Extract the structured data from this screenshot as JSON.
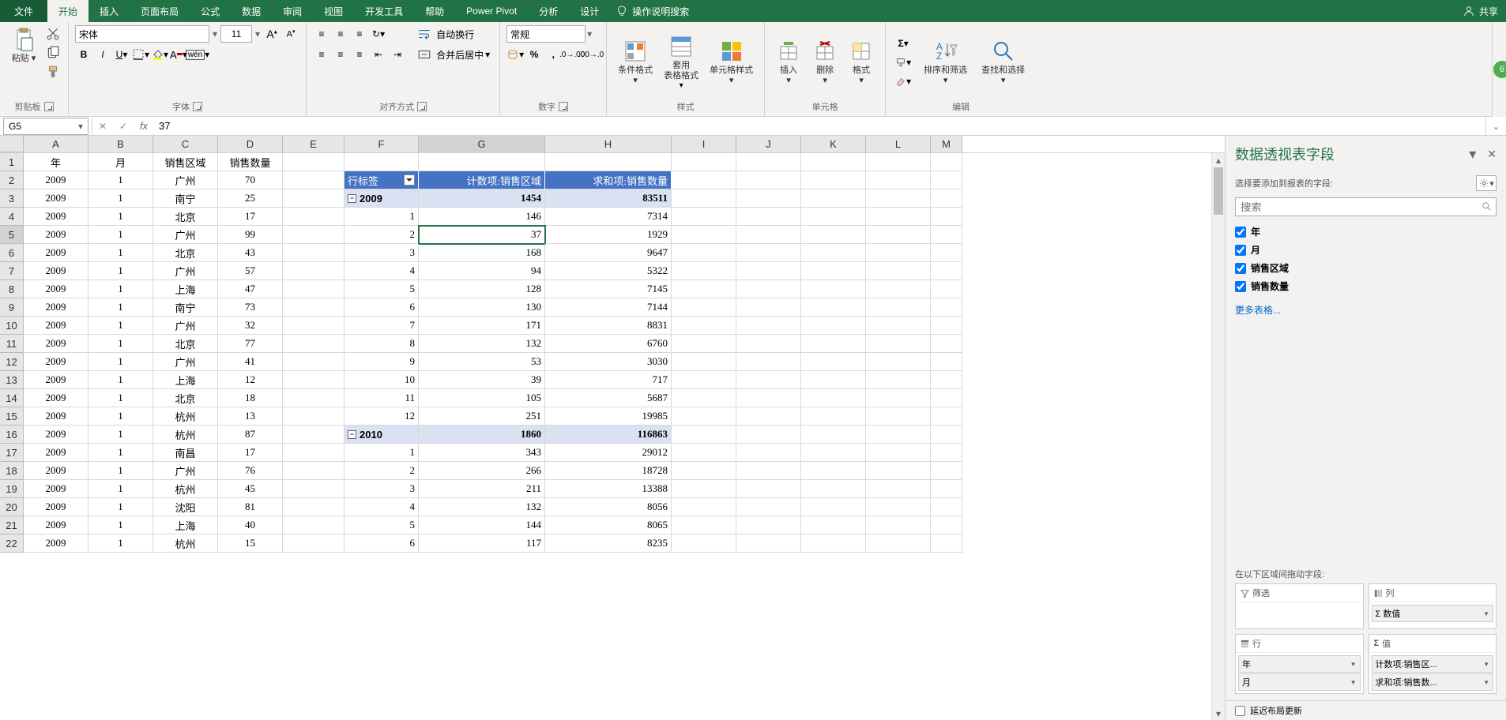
{
  "tabs": {
    "file": "文件",
    "home": "开始",
    "insert": "插入",
    "layout": "页面布局",
    "formulas": "公式",
    "data": "数据",
    "review": "审阅",
    "view": "视图",
    "dev": "开发工具",
    "help": "帮助",
    "pivot": "Power Pivot",
    "analyze": "分析",
    "design": "设计"
  },
  "search_hint": "操作说明搜索",
  "share": "共享",
  "ribbon": {
    "clipboard": {
      "paste": "粘贴",
      "label": "剪贴板"
    },
    "font": {
      "name": "宋体",
      "size": "11",
      "label": "字体"
    },
    "align": {
      "wrap": "自动换行",
      "merge": "合并后居中",
      "label": "对齐方式"
    },
    "number": {
      "format": "常规",
      "label": "数字"
    },
    "styles": {
      "cond": "条件格式",
      "table": "套用\n表格格式",
      "cell": "单元格样式",
      "label": "样式"
    },
    "cells": {
      "insert": "插入",
      "delete": "删除",
      "format": "格式",
      "label": "单元格"
    },
    "editing": {
      "sort": "排序和筛选",
      "find": "查找和选择",
      "label": "编辑"
    },
    "badge": "6"
  },
  "name_box": "G5",
  "formula": "37",
  "columns": [
    "A",
    "B",
    "C",
    "D",
    "E",
    "F",
    "G",
    "H",
    "I",
    "J",
    "K",
    "L",
    "M"
  ],
  "col_widths": [
    "w-A",
    "w-B",
    "w-C",
    "w-D",
    "w-E",
    "w-F",
    "w-G",
    "w-H",
    "w-I",
    "w-J",
    "w-K",
    "w-L",
    "w-M"
  ],
  "headers": {
    "A": "年",
    "B": "月",
    "C": "销售区域",
    "D": "销售数量"
  },
  "source_rows": [
    [
      "2009",
      "1",
      "广州",
      "70"
    ],
    [
      "2009",
      "1",
      "南宁",
      "25"
    ],
    [
      "2009",
      "1",
      "北京",
      "17"
    ],
    [
      "2009",
      "1",
      "广州",
      "99"
    ],
    [
      "2009",
      "1",
      "北京",
      "43"
    ],
    [
      "2009",
      "1",
      "广州",
      "57"
    ],
    [
      "2009",
      "1",
      "上海",
      "47"
    ],
    [
      "2009",
      "1",
      "南宁",
      "73"
    ],
    [
      "2009",
      "1",
      "广州",
      "32"
    ],
    [
      "2009",
      "1",
      "北京",
      "77"
    ],
    [
      "2009",
      "1",
      "广州",
      "41"
    ],
    [
      "2009",
      "1",
      "上海",
      "12"
    ],
    [
      "2009",
      "1",
      "北京",
      "18"
    ],
    [
      "2009",
      "1",
      "杭州",
      "13"
    ],
    [
      "2009",
      "1",
      "杭州",
      "87"
    ],
    [
      "2009",
      "1",
      "南昌",
      "17"
    ],
    [
      "2009",
      "1",
      "广州",
      "76"
    ],
    [
      "2009",
      "1",
      "杭州",
      "45"
    ],
    [
      "2009",
      "1",
      "沈阳",
      "81"
    ],
    [
      "2009",
      "1",
      "上海",
      "40"
    ],
    [
      "2009",
      "1",
      "杭州",
      "15"
    ]
  ],
  "pivot": {
    "hdr_row": "行标签",
    "hdr_count": "计数项:销售区域",
    "hdr_sum": "求和项:销售数量",
    "rows": [
      {
        "type": "sub",
        "label": "2009",
        "g": "1454",
        "h": "83511"
      },
      {
        "type": "d",
        "label": "1",
        "g": "146",
        "h": "7314"
      },
      {
        "type": "d",
        "label": "2",
        "g": "37",
        "h": "1929"
      },
      {
        "type": "d",
        "label": "3",
        "g": "168",
        "h": "9647"
      },
      {
        "type": "d",
        "label": "4",
        "g": "94",
        "h": "5322"
      },
      {
        "type": "d",
        "label": "5",
        "g": "128",
        "h": "7145"
      },
      {
        "type": "d",
        "label": "6",
        "g": "130",
        "h": "7144"
      },
      {
        "type": "d",
        "label": "7",
        "g": "171",
        "h": "8831"
      },
      {
        "type": "d",
        "label": "8",
        "g": "132",
        "h": "6760"
      },
      {
        "type": "d",
        "label": "9",
        "g": "53",
        "h": "3030"
      },
      {
        "type": "d",
        "label": "10",
        "g": "39",
        "h": "717"
      },
      {
        "type": "d",
        "label": "11",
        "g": "105",
        "h": "5687"
      },
      {
        "type": "d",
        "label": "12",
        "g": "251",
        "h": "19985"
      },
      {
        "type": "sub",
        "label": "2010",
        "g": "1860",
        "h": "116863"
      },
      {
        "type": "d",
        "label": "1",
        "g": "343",
        "h": "29012"
      },
      {
        "type": "d",
        "label": "2",
        "g": "266",
        "h": "18728"
      },
      {
        "type": "d",
        "label": "3",
        "g": "211",
        "h": "13388"
      },
      {
        "type": "d",
        "label": "4",
        "g": "132",
        "h": "8056"
      },
      {
        "type": "d",
        "label": "5",
        "g": "144",
        "h": "8065"
      },
      {
        "type": "d",
        "label": "6",
        "g": "117",
        "h": "8235"
      }
    ]
  },
  "pane": {
    "title": "数据透视表字段",
    "choose": "选择要添加到报表的字段:",
    "search_ph": "搜索",
    "fields": [
      "年",
      "月",
      "销售区域",
      "销售数量"
    ],
    "more": "更多表格...",
    "drag": "在以下区域间拖动字段:",
    "filter": "筛选",
    "columns": "列",
    "rows": "行",
    "values": "值",
    "col_item": "Σ 数值",
    "row_items": [
      "年",
      "月"
    ],
    "val_items": [
      "计数项:销售区...",
      "求和项:销售数..."
    ],
    "defer": "延迟布局更新"
  }
}
